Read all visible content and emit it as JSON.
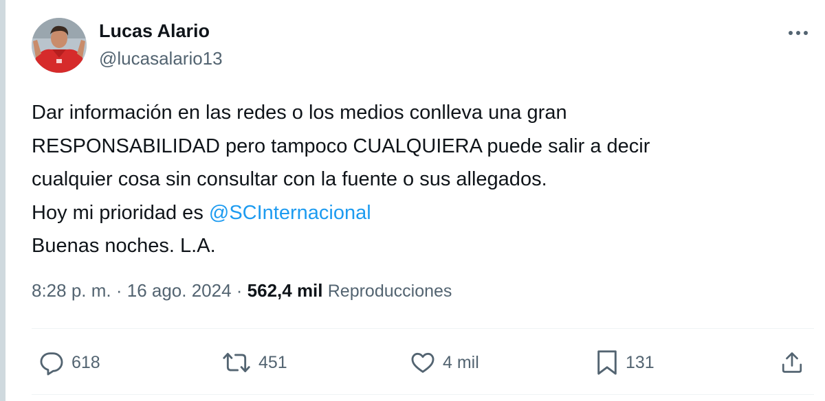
{
  "author": {
    "display_name": "Lucas Alario",
    "handle": "@lucasalario13"
  },
  "tweet": {
    "lines": [
      {
        "text": "Dar información en las redes o los medios conlleva una gran"
      },
      {
        "text": "RESPONSABILIDAD pero tampoco CUALQUIERA puede salir a decir"
      },
      {
        "text": "cualquier cosa sin consultar con la fuente o sus allegados."
      },
      {
        "text": "Hoy mi prioridad es ",
        "mention": "@SCInternacional"
      },
      {
        "text": "Buenas noches. L.A."
      }
    ]
  },
  "meta": {
    "time": "8:28 p. m.",
    "separator": " · ",
    "date": "16 ago. 2024",
    "views_count": "562,4 mil",
    "views_label": "Reproducciones"
  },
  "actions": {
    "replies": "618",
    "reposts": "451",
    "likes": "4 mil",
    "bookmarks": "131"
  },
  "icons": {
    "more": "more-horizontal-icon",
    "reply": "reply-icon",
    "repost": "repost-icon",
    "like": "heart-icon",
    "bookmark": "bookmark-icon",
    "share": "share-icon"
  },
  "colors": {
    "text": "#0f1419",
    "secondary": "#536471",
    "link": "#1d9bf0",
    "divider": "#eff3f4"
  }
}
